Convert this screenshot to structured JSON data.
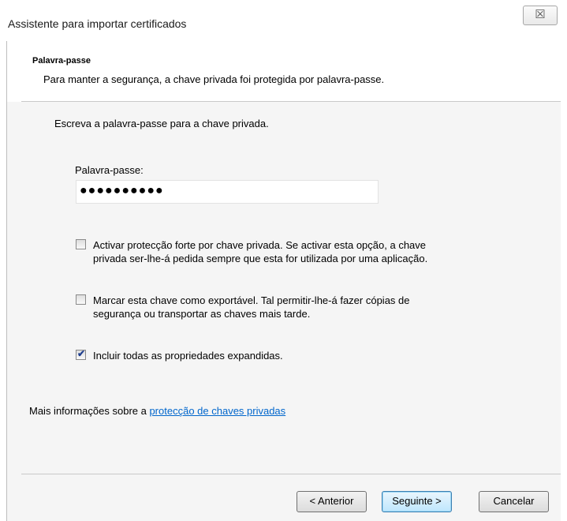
{
  "window": {
    "title": "Assistente para importar certificados",
    "close_glyph": "☒"
  },
  "header": {
    "title": "Palavra-passe",
    "subtitle": "Para manter a segurança, a chave privada foi protegida por palavra-passe."
  },
  "form": {
    "prompt": "Escreva a palavra-passe para a chave privada.",
    "password_label": "Palavra-passe:",
    "password_value": "●●●●●●●●●●"
  },
  "options": [
    {
      "lines": [
        "Activar protecção forte por chave privada. Se activar esta opção, a chave",
        "privada ser-lhe-á pedida sempre que esta for utilizada por uma aplicação."
      ],
      "checked": false
    },
    {
      "lines": [
        "Marcar esta chave como exportável. Tal permitir-lhe-á fazer cópias de",
        "segurança ou transportar as chaves mais tarde."
      ],
      "checked": false
    },
    {
      "lines": [
        "Incluir todas as propriedades expandidas."
      ],
      "checked": true
    }
  ],
  "more_info": {
    "prefix": "Mais informações sobre a ",
    "link": "protecção de chaves privadas"
  },
  "buttons": {
    "back": "< Anterior",
    "next": "Seguinte >",
    "cancel": "Cancelar"
  },
  "checkmark": "✔"
}
